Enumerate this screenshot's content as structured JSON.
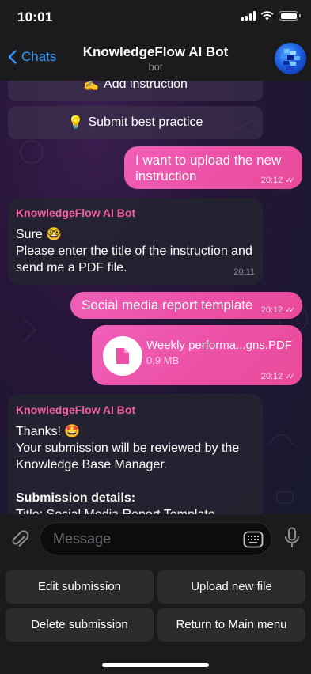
{
  "status_bar": {
    "time": "10:01"
  },
  "nav": {
    "back_label": "Chats",
    "title": "KnowledgeFlow AI Bot",
    "subtitle": "bot"
  },
  "inline_keyboard": {
    "add_instruction": {
      "emoji": "✍️",
      "label": "Add instruction"
    },
    "submit_best_practice": {
      "emoji": "💡",
      "label": "Submit best practice"
    }
  },
  "messages": {
    "out_upload": {
      "text": "I want to upload the new instruction",
      "time": "20:12"
    },
    "in_sure": {
      "sender": "KnowledgeFlow AI Bot",
      "line1": "Sure 🤓",
      "line2": "Please enter the title of the instruction and send me a PDF file.",
      "time": "20:11"
    },
    "out_title": {
      "text": "Social media report template",
      "time": "20:12"
    },
    "out_file": {
      "filename": "Weekly performa...gns.PDF",
      "size": "0,9 MB",
      "time": "20:12"
    },
    "in_thanks": {
      "sender": "KnowledgeFlow AI Bot",
      "line1": "Thanks! 🤩",
      "line2": "Your submission will be reviewed by the Knowledge Base Manager.",
      "details_heading": "Submission details:",
      "details_title": "Title: Social Media Report Template"
    }
  },
  "input": {
    "placeholder": "Message"
  },
  "reply_keyboard": {
    "edit": "Edit submission",
    "upload": "Upload new file",
    "delete": "Delete submission",
    "main_menu": "Return to Main menu"
  },
  "colors": {
    "accent_blue": "#2f9bff",
    "outgoing_bubble": "#ec4fa5",
    "sender_name": "#f25fa8",
    "bar_background": "#1b1b1d"
  },
  "icons": [
    "back-chevron-icon",
    "signal-icon",
    "wifi-icon",
    "battery-icon",
    "file-icon",
    "attach-icon",
    "keyboard-icon",
    "mic-icon"
  ]
}
